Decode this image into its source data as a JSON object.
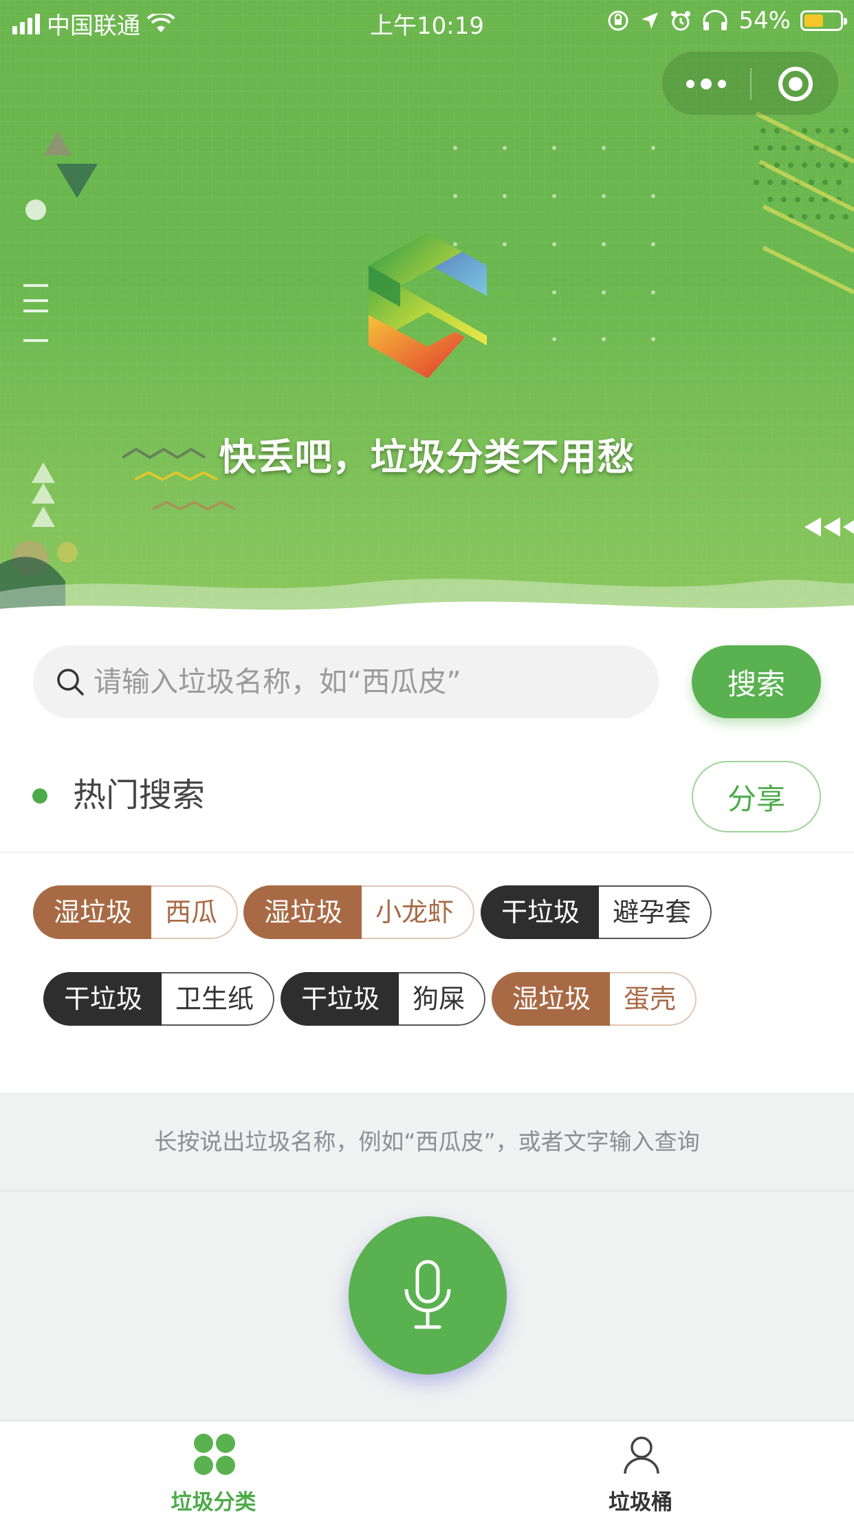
{
  "status_bar": {
    "carrier": "中国联通",
    "time": "上午10:19",
    "battery_text": "54%",
    "battery_level": 0.54
  },
  "hero": {
    "title": "快丢吧，垃圾分类不用愁"
  },
  "search": {
    "placeholder": "请输入垃圾名称，如“西瓜皮”",
    "button_label": "搜索"
  },
  "hot": {
    "title": "热门搜索",
    "share_label": "分享",
    "tags": [
      {
        "category": "湿垃圾",
        "item": "西瓜",
        "type": "wet"
      },
      {
        "category": "湿垃圾",
        "item": "小龙虾",
        "type": "wet"
      },
      {
        "category": "干垃圾",
        "item": "避孕套",
        "type": "dry"
      },
      {
        "category": "干垃圾",
        "item": "卫生纸",
        "type": "dry"
      },
      {
        "category": "干垃圾",
        "item": "狗屎",
        "type": "dry"
      },
      {
        "category": "湿垃圾",
        "item": "蛋壳",
        "type": "wet"
      }
    ]
  },
  "voice": {
    "hint": "长按说出垃圾名称，例如“西瓜皮”，或者文字输入查询"
  },
  "tabbar": {
    "items": [
      {
        "label": "垃圾分类",
        "icon": "grid-dots-icon",
        "active": true
      },
      {
        "label": "垃圾桶",
        "icon": "user-icon",
        "active": false
      }
    ]
  },
  "colors": {
    "brand_green": "#5ab150",
    "wet_tag": "#a86a45",
    "dry_tag": "#2e2e2e",
    "battery": "#f5c52a"
  }
}
